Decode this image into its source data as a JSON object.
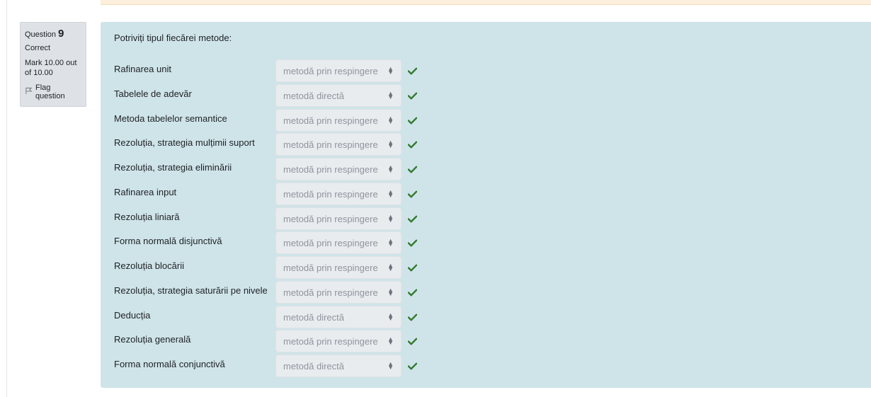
{
  "question": {
    "number_label": "Question",
    "number": "9",
    "state": "Correct",
    "grade": "Mark 10.00 out of 10.00",
    "flag_label": "Flag question",
    "prompt": "Potriviți tipul fiecărei metode:",
    "rows": [
      {
        "label": "Rafinarea unit",
        "value": "metodă prin respingere"
      },
      {
        "label": "Tabelele de adevăr",
        "value": "metodă directă"
      },
      {
        "label": "Metoda tabelelor semantice",
        "value": "metodă prin respingere"
      },
      {
        "label": "Rezoluția, strategia mulțimii suport",
        "value": "metodă prin respingere"
      },
      {
        "label": "Rezoluția, strategia eliminării",
        "value": "metodă prin respingere"
      },
      {
        "label": "Rafinarea input",
        "value": "metodă prin respingere"
      },
      {
        "label": "Rezoluția liniară",
        "value": "metodă prin respingere"
      },
      {
        "label": "Forma normală disjunctivă",
        "value": "metodă prin respingere"
      },
      {
        "label": "Rezoluția blocării",
        "value": "metodă prin respingere"
      },
      {
        "label": "Rezoluția, strategia saturării pe nivele",
        "value": "metodă prin respingere"
      },
      {
        "label": "Deducția",
        "value": "metodă directă"
      },
      {
        "label": "Rezoluția generală",
        "value": "metodă prin respingere"
      },
      {
        "label": "Forma normală conjunctivă",
        "value": "metodă directă"
      }
    ]
  },
  "colors": {
    "panel_bg": "#cfe4e9",
    "info_bg": "#dee2e6",
    "check": "#357a32",
    "select_text": "#8f959e"
  },
  "icons": {
    "flag": "flag-icon",
    "correct": "check-icon",
    "select": "select-arrows-icon"
  }
}
